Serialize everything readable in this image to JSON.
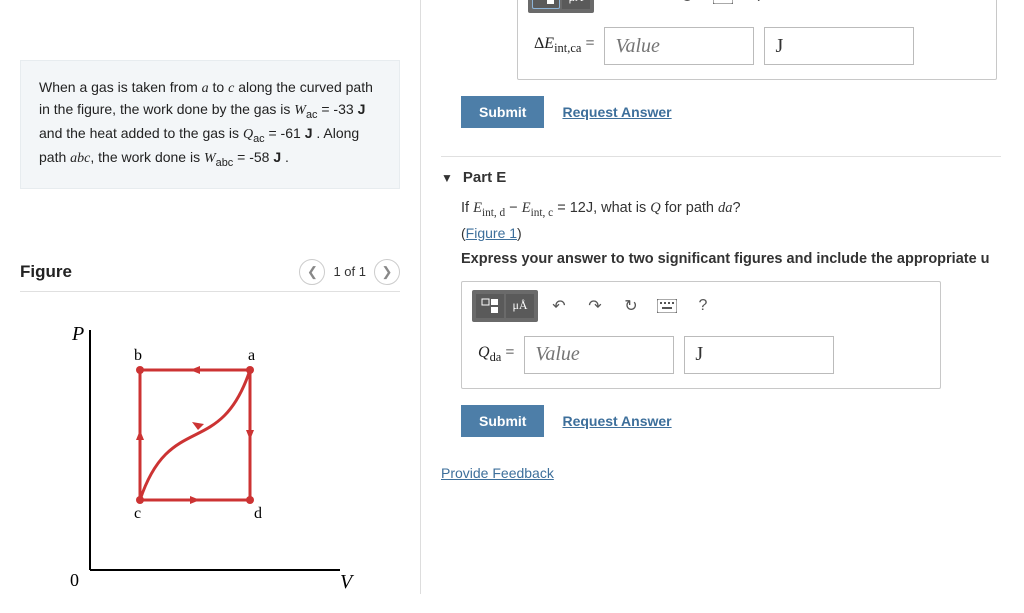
{
  "problem": {
    "text_pre": "When a gas is taken from ",
    "a": "a",
    "text_to": " to ",
    "c": "c",
    "text_mid1": " along the curved path in the figure, the work done by the gas is ",
    "Wac_sym": "W",
    "Wac_sub": "ac",
    "Wac_eq": " = -33 ",
    "J1": "J",
    "text_mid2": " and the heat added to the gas is ",
    "Qac_sym": "Q",
    "Qac_sub": "ac",
    "Qac_eq": " = -61 ",
    "J2": "J",
    "text_mid3": " . Along path ",
    "abc": "abc",
    "text_mid4": ", the work done is ",
    "Wabc_sym": "W",
    "Wabc_sub": "abc",
    "Wabc_eq": " = -58 ",
    "J3": "J",
    "text_end": " ."
  },
  "figure": {
    "title": "Figure",
    "pager": "1 of 1",
    "labels": {
      "P": "P",
      "V": "V",
      "zero": "0",
      "a": "a",
      "b": "b",
      "c": "c",
      "d": "d"
    }
  },
  "partTop": {
    "var_prefix": "Δ",
    "var_E": "E",
    "var_sub": "int,ca",
    "eq": " =",
    "placeholder": "Value",
    "unit": "J",
    "submit": "Submit",
    "request": "Request Answer"
  },
  "toolbar": {
    "sym_btn": "μÅ",
    "help": "?"
  },
  "partE": {
    "title": "Part E",
    "p_if": "If ",
    "E1": "E",
    "E1sub": "int, d",
    "minus": " − ",
    "E2": "E",
    "E2sub": "int, c",
    "eq12": " = 12",
    "J": "J",
    "what": ", what is ",
    "Q": "Q",
    "path": " for path ",
    "da": "da",
    "qmark": "?",
    "fig_link": "Figure 1",
    "instruct": "Express your answer to two significant figures and include the appropriate u",
    "var_Q": "Q",
    "var_sub": "da",
    "eq": " =",
    "placeholder": "Value",
    "unit": "J",
    "submit": "Submit",
    "request": "Request Answer"
  },
  "feedback": "Provide Feedback"
}
